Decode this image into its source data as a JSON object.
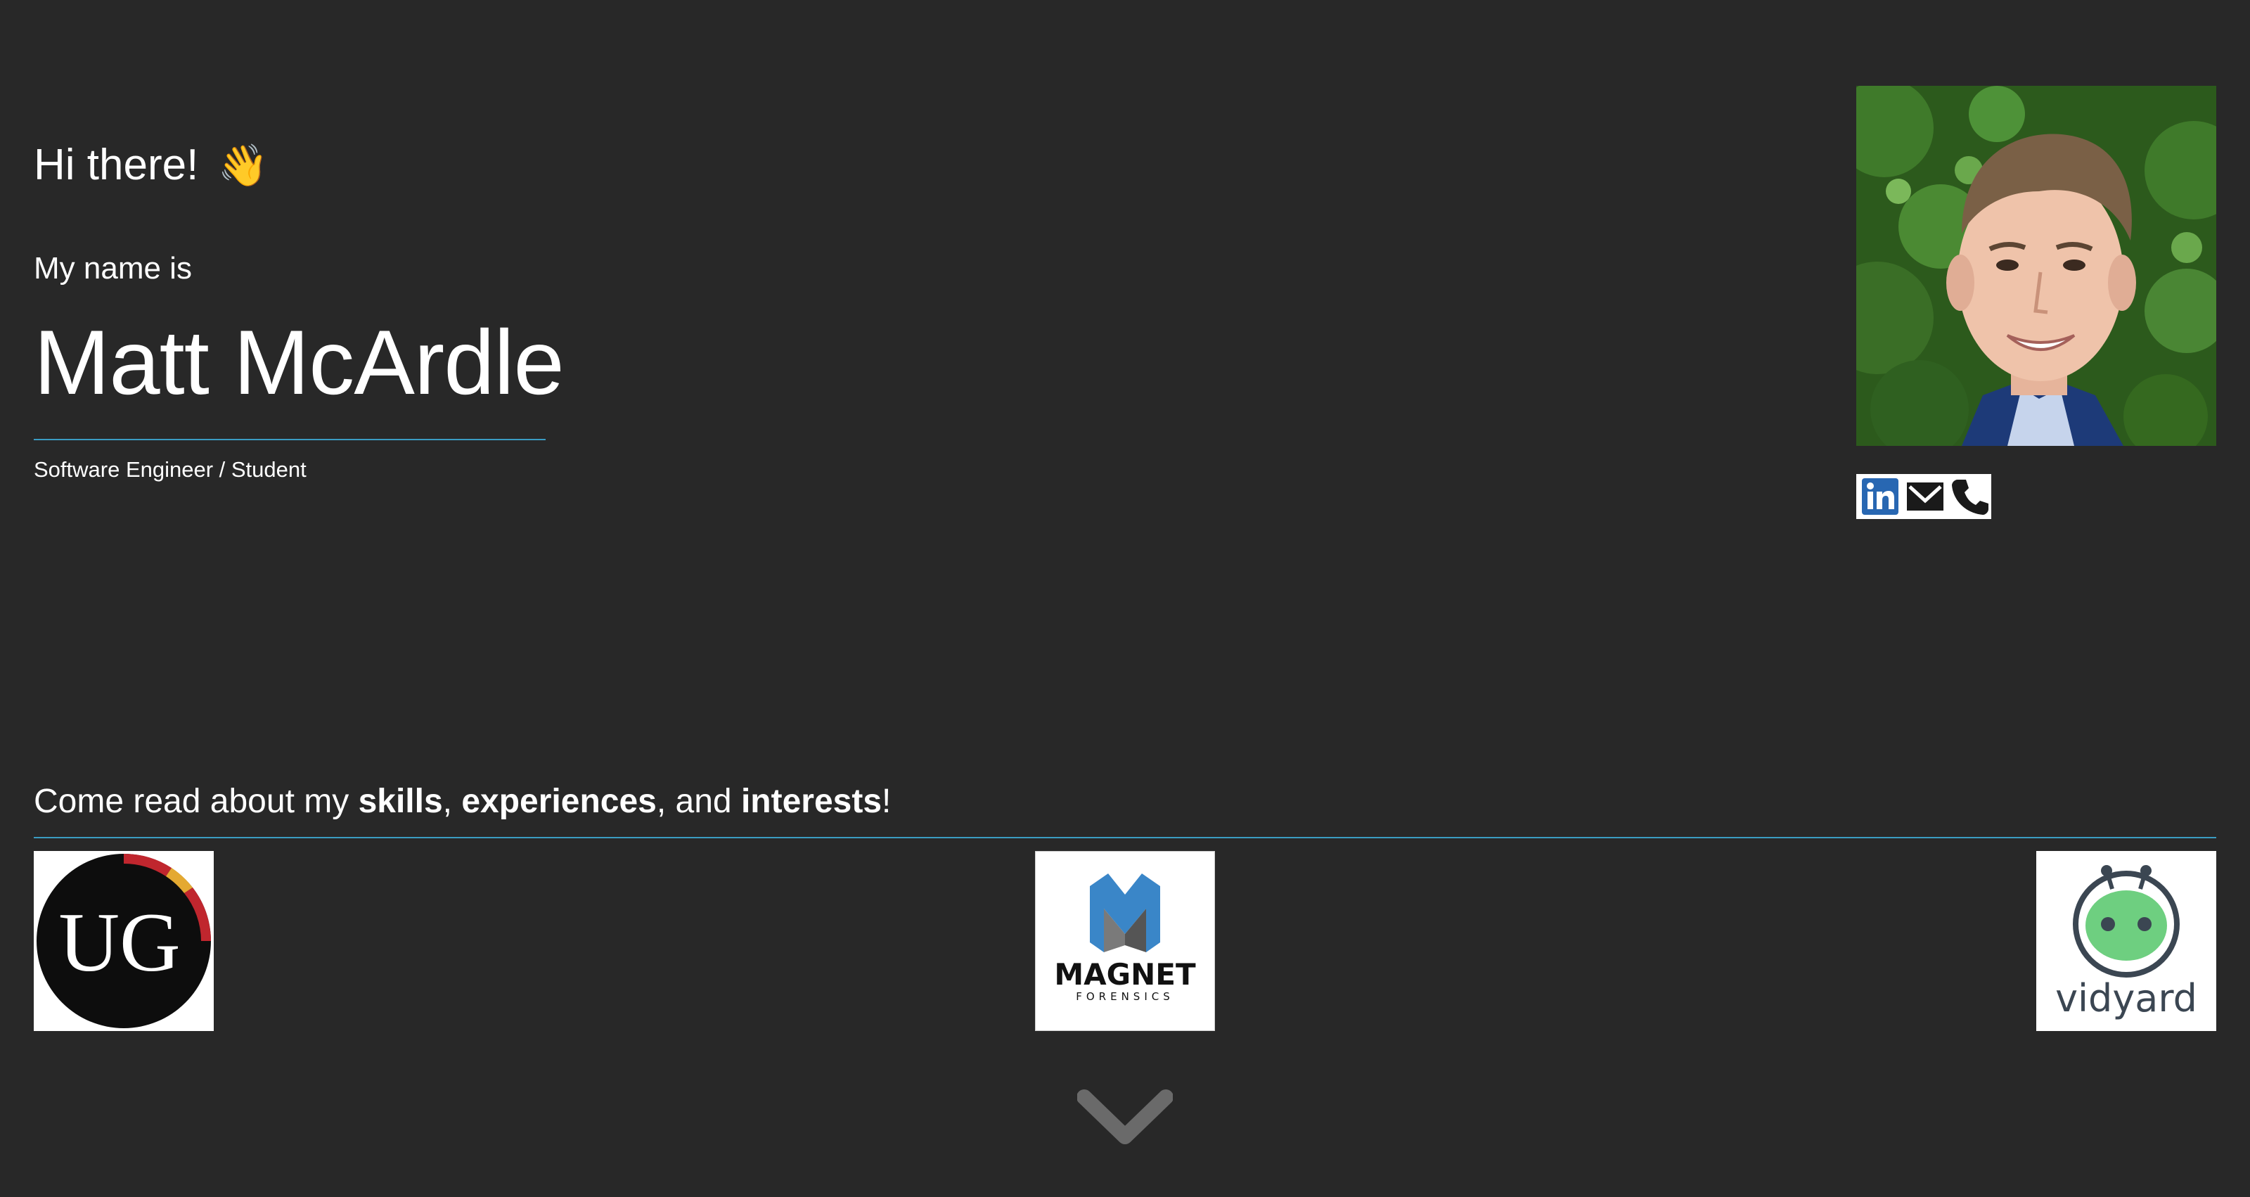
{
  "hero": {
    "greeting": "Hi there!",
    "wave_emoji": "👋",
    "name_intro": "My name is",
    "name": "Matt McArdle",
    "role": "Software Engineer / Student"
  },
  "contacts": [
    {
      "icon": "linkedin-icon",
      "label": "LinkedIn"
    },
    {
      "icon": "email-icon",
      "label": "Email"
    },
    {
      "icon": "phone-icon",
      "label": "Phone"
    }
  ],
  "cta": {
    "prefix": "Come read about my ",
    "skills": "skills",
    "sep1": ", ",
    "experiences": "experiences",
    "sep2": ", and ",
    "interests": "interests",
    "suffix": "!"
  },
  "logos": {
    "ug": {
      "text": "UG"
    },
    "magnet": {
      "title": "MAGNET",
      "subtitle": "FORENSICS"
    },
    "vidyard": {
      "text": "vidyard"
    }
  },
  "colors": {
    "background": "#282828",
    "accent_rule": "#3a9cc2",
    "linkedin_blue": "#2867b2",
    "vidyard_green": "#6ecf80",
    "ug_red": "#c0262e",
    "ug_gold": "#e4a931",
    "magnet_blue": "#3a86c8"
  }
}
